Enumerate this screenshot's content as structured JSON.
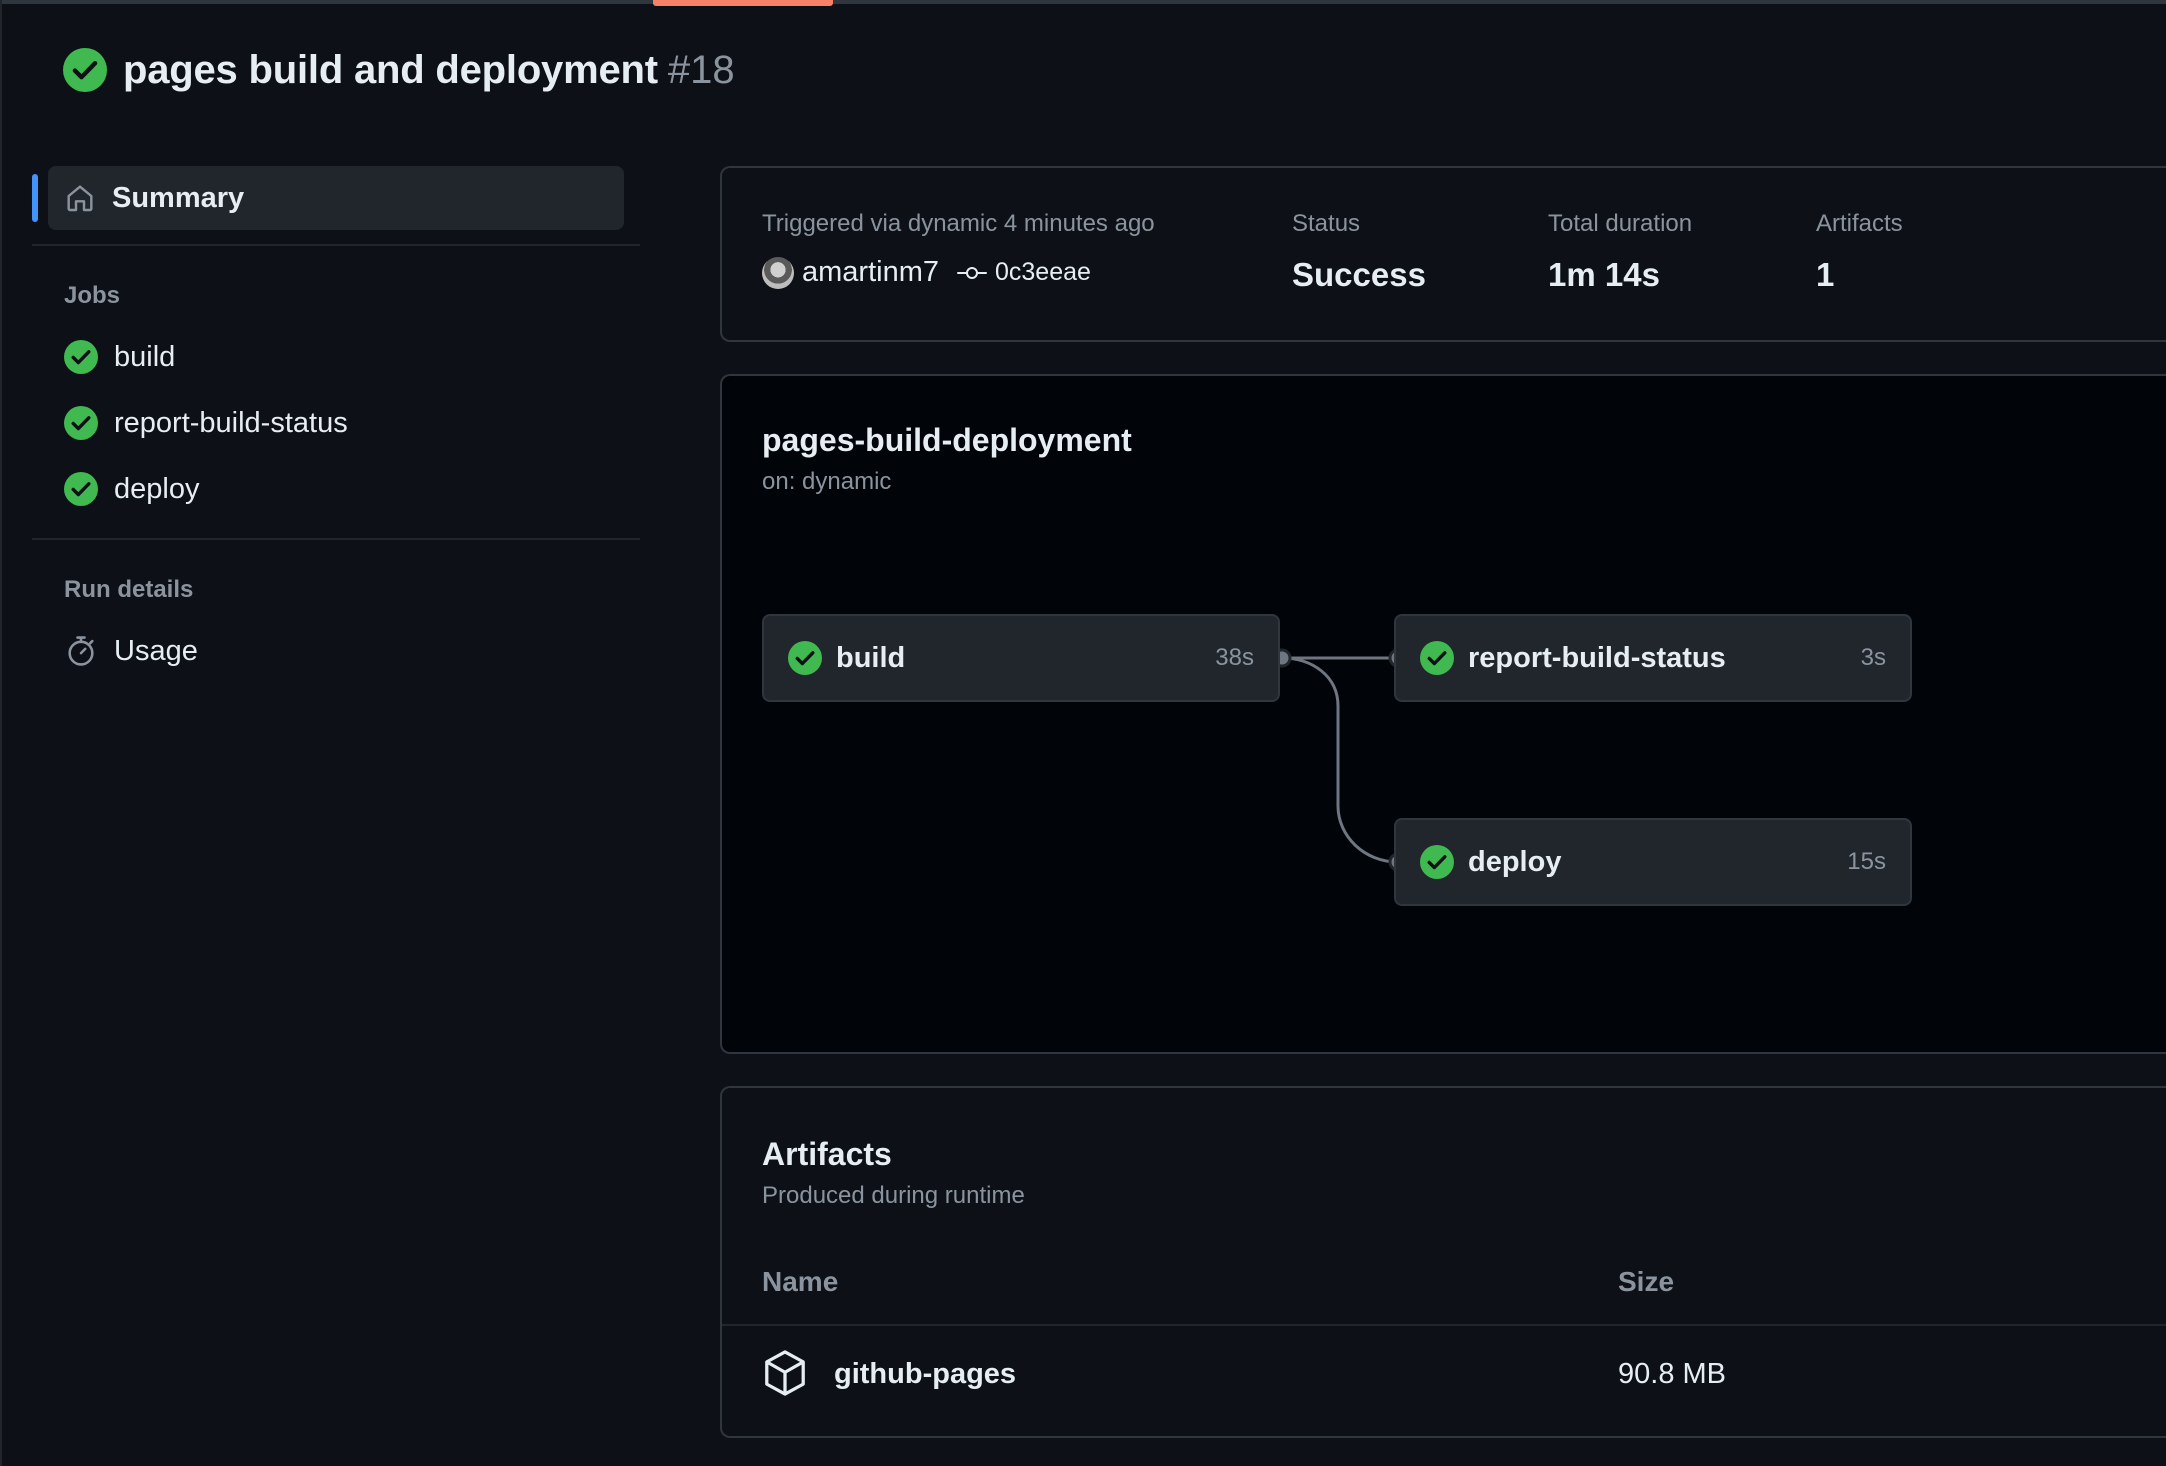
{
  "run": {
    "title": "pages build and deployment",
    "number": "#18",
    "status_icon": "check-circle-fill-icon"
  },
  "sidebar": {
    "summary_label": "Summary",
    "jobs_heading": "Jobs",
    "jobs": [
      {
        "label": "build",
        "status": "success"
      },
      {
        "label": "report-build-status",
        "status": "success"
      },
      {
        "label": "deploy",
        "status": "success"
      }
    ],
    "run_details_heading": "Run details",
    "usage_label": "Usage"
  },
  "summary": {
    "trigger_text": "Triggered via dynamic 4 minutes ago",
    "actor": "amartinm7",
    "commit_sha": "0c3eeae",
    "status_label": "Status",
    "status_value": "Success",
    "duration_label": "Total duration",
    "duration_value": "1m 14s",
    "artifacts_label": "Artifacts",
    "artifacts_value": "1"
  },
  "workflow_graph": {
    "title": "pages-build-deployment",
    "subtitle": "on: dynamic",
    "nodes": [
      {
        "name": "build",
        "duration": "38s"
      },
      {
        "name": "report-build-status",
        "duration": "3s"
      },
      {
        "name": "deploy",
        "duration": "15s"
      }
    ]
  },
  "artifacts": {
    "title": "Artifacts",
    "subtitle": "Produced during runtime",
    "column_name": "Name",
    "column_size": "Size",
    "items": [
      {
        "name": "github-pages",
        "size": "90.8 MB"
      }
    ]
  },
  "colors": {
    "background": "#0d1117",
    "success": "#3fb950",
    "accent": "#4493f8",
    "tab_underline": "#f78166",
    "muted_text": "#8b949e"
  }
}
